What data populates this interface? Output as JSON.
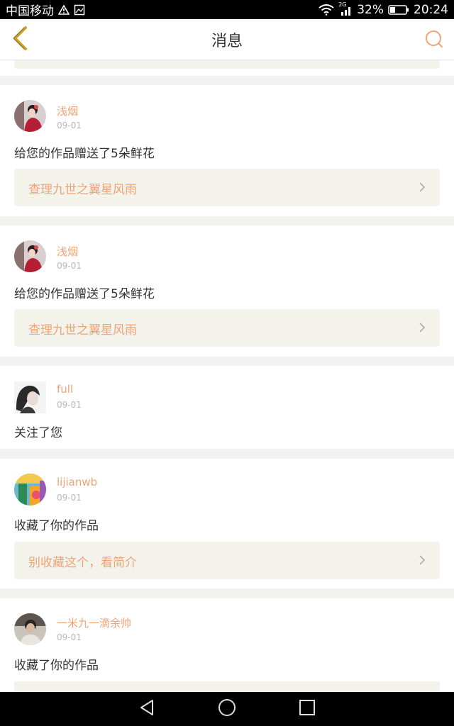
{
  "status_bar": {
    "carrier": "中国移动",
    "network": "2G",
    "battery": "32%",
    "time": "20:24",
    "icons": [
      "warning-icon",
      "image-icon",
      "wifi-icon",
      "signal-icon",
      "battery-icon"
    ]
  },
  "header": {
    "title": "消息",
    "back_icon": "chevron-left-icon",
    "search_icon": "search-icon"
  },
  "messages": [
    {
      "username": "浅烟",
      "date": "09-01",
      "action": "给您的作品赠送了5朵鲜花",
      "link": "查理九世之翼星风雨",
      "avatar": "avatar-red-costume"
    },
    {
      "username": "浅烟",
      "date": "09-01",
      "action": "给您的作品赠送了5朵鲜花",
      "link": "查理九世之翼星风雨",
      "avatar": "avatar-red-costume"
    },
    {
      "username": "full",
      "date": "09-01",
      "action": "关注了您",
      "link": "",
      "avatar": "avatar-dark-hair"
    },
    {
      "username": "lijianwb",
      "date": "09-01",
      "action": "收藏了你的作品",
      "link": "别收藏这个，看简介",
      "avatar": "avatar-colorful"
    },
    {
      "username": "一米九一滴余帅",
      "date": "09-01",
      "action": "收藏了你的作品",
      "link": "",
      "avatar": "avatar-person"
    }
  ],
  "nav_bar": {
    "icons": [
      "back-triangle-icon",
      "home-circle-icon",
      "recents-square-icon"
    ]
  },
  "colors": {
    "accent": "#f0a374",
    "icon_accent": "#c9a21f",
    "link_bg": "#f3f3ec",
    "page_bg": "#f2f2f0"
  }
}
